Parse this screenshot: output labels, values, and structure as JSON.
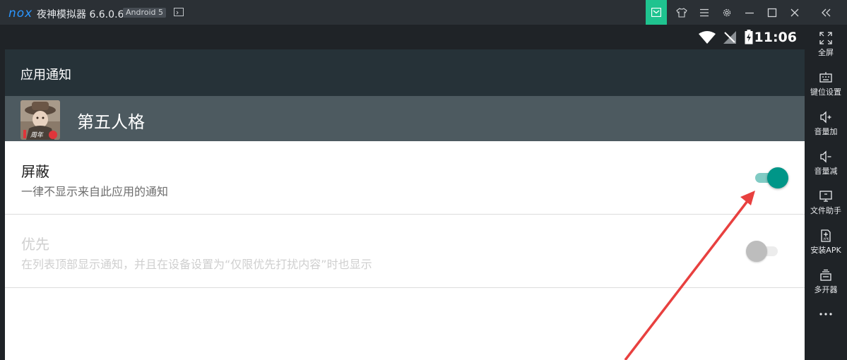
{
  "titlebar": {
    "logo": "nox",
    "app_title": "夜神模拟器 6.6.0.6",
    "android_badge": "Android 5",
    "buttons": [
      {
        "icon": "message-icon",
        "active": true
      },
      {
        "icon": "shirt-icon"
      },
      {
        "icon": "menu-icon"
      },
      {
        "icon": "gear-icon"
      },
      {
        "icon": "minimize-icon"
      },
      {
        "icon": "maximize-icon"
      },
      {
        "icon": "close-icon"
      },
      {
        "icon": "collapse-icon"
      }
    ]
  },
  "statusbar": {
    "time": "11:06",
    "icons": [
      "wifi-icon",
      "no-signal-icon",
      "battery-charging-icon"
    ]
  },
  "appbar": {
    "title": "应用通知"
  },
  "app": {
    "name": "第五人格",
    "icon": "identity-v-app-icon",
    "icon_text": "周年"
  },
  "settings": [
    {
      "title": "屏蔽",
      "subtitle": "一律不显示来自此应用的通知",
      "enabled": true,
      "toggle_on": true
    },
    {
      "title": "优先",
      "subtitle": "在列表顶部显示通知，并且在设备设置为“仅限优先打扰内容”时也显示",
      "enabled": false,
      "toggle_on": false
    }
  ],
  "sidebar": {
    "items": [
      {
        "label": "全屏",
        "icon": "fullscreen-icon"
      },
      {
        "label": "键位设置",
        "icon": "keyboard-icon"
      },
      {
        "label": "音量加",
        "icon": "volume-up-icon"
      },
      {
        "label": "音量减",
        "icon": "volume-down-icon"
      },
      {
        "label": "文件助手",
        "icon": "file-assistant-icon"
      },
      {
        "label": "安装APK",
        "icon": "install-apk-icon"
      },
      {
        "label": "多开器",
        "icon": "multi-instance-icon"
      }
    ],
    "more": "more-icon"
  },
  "colors": {
    "accent_toggle": "#009688",
    "titlebar_active": "#1fc38f",
    "annotation_arrow": "#e8403f"
  }
}
